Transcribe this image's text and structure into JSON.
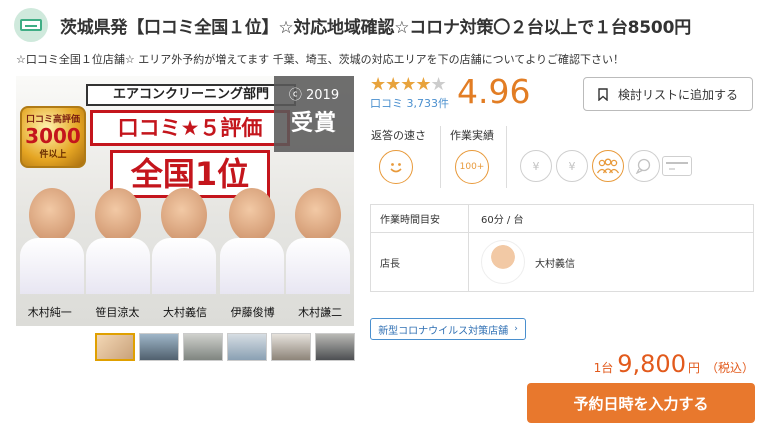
{
  "header": {
    "title": "茨城県発【口コミ全国１位】☆対応地域確認☆コロナ対策〇２台以上で１台8500円"
  },
  "subtitle": "☆口コミ全国１位店舗☆ エリア外予約が増えてます 千葉、埼玉、茨城の対応エリアを下の店舗についてよりご確認下さい！",
  "hero": {
    "banner_top": "エアコンクリーニング部門",
    "banner_mid": "口コミ★５評価",
    "banner_big": "全国1位",
    "medal_line1": "口コミ高評価",
    "medal_number": "3000",
    "medal_line3": "件以上",
    "award_year": "2019",
    "award_label": "受賞",
    "staff_names": [
      "木村純一",
      "笹目涼太",
      "大村義信",
      "伊藤俊博",
      "木村謙二"
    ]
  },
  "rating": {
    "stars_on": "★★★★",
    "stars_off": "★",
    "score": "4.96",
    "reviews_label": "口コミ",
    "reviews_count": "3,733件"
  },
  "wishlist_label": "検討リストに追加する",
  "stats": {
    "response_label": "返答の速さ",
    "jobs_label": "作業実績",
    "jobs_badge": "100+"
  },
  "info": {
    "work_time_key": "作業時間目安",
    "work_time_val": "60分 / 台",
    "manager_key": "店長",
    "manager_name": "大村義信"
  },
  "covid_label": "新型コロナウイルス対策店舗",
  "price": {
    "unit": "1台",
    "amount": "9,800",
    "yen": "円",
    "tax": "（税込）"
  },
  "reserve_label": "予約日時を入力する",
  "colors": {
    "accent": "#e8782d",
    "price": "#e25a1c",
    "star": "#e8a33c",
    "link": "#4a8fce"
  }
}
